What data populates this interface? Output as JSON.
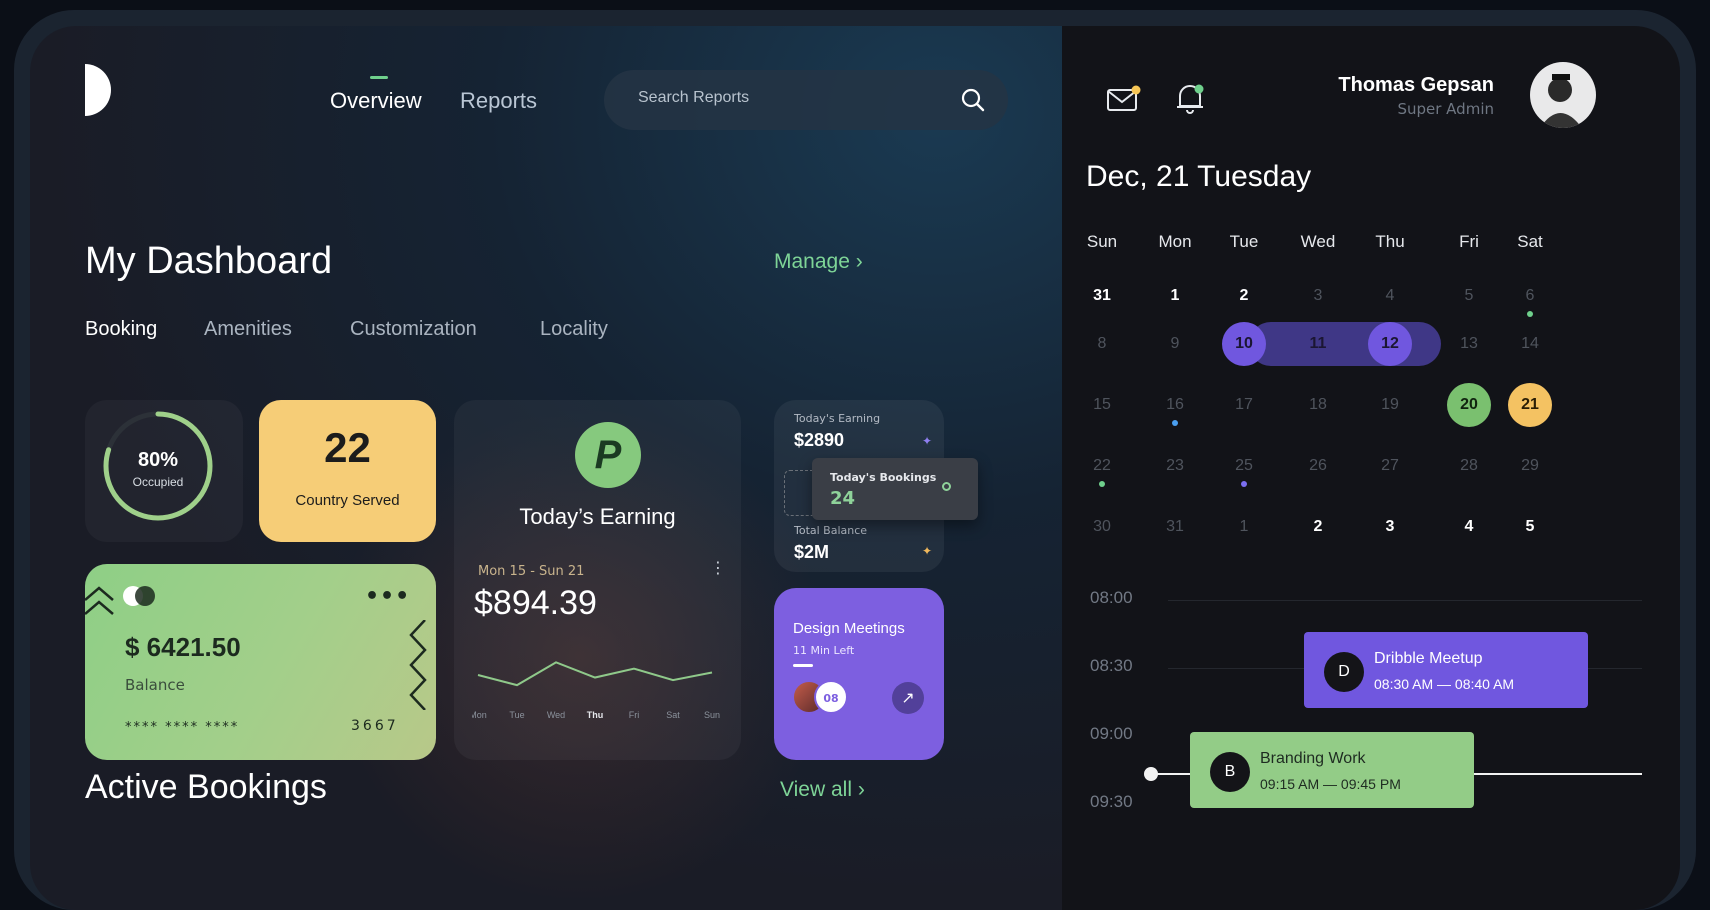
{
  "nav": {
    "overview": "Overview",
    "reports": "Reports"
  },
  "search": {
    "placeholder": "Search Reports"
  },
  "dashboard": {
    "title": "My Dashboard",
    "manage": "Manage",
    "tabs": [
      "Booking",
      "Amenities",
      "Customization",
      "Locality"
    ]
  },
  "occupied": {
    "percent": "80%",
    "label": "Occupied",
    "fraction": 0.8
  },
  "country": {
    "value": "22",
    "label": "Country Served"
  },
  "balance_card": {
    "amount": "$ 6421.50",
    "label": "Balance",
    "masked": "****  ****  ****",
    "last4": "3667",
    "menu": "•••"
  },
  "earning": {
    "badge": "P",
    "title": "Today’s Earning",
    "range": "Mon 15 - Sun 21",
    "menu": "⋮",
    "value": "$894.39",
    "days": [
      "Mon",
      "Tue",
      "Wed",
      "Thu",
      "Fri",
      "Sat",
      "Sun"
    ],
    "chart_data": {
      "type": "line",
      "x": [
        "Mon",
        "Tue",
        "Wed",
        "Thu",
        "Fri",
        "Sat",
        "Sun"
      ],
      "series": [
        {
          "values": [
            30,
            22,
            40,
            28,
            35,
            26,
            32
          ]
        }
      ]
    }
  },
  "mini_stats": {
    "today_earning_label": "Today's Earning",
    "today_earning_value": "$2890",
    "total_balance_label": "Total Balance",
    "total_balance_value": "$2M",
    "bookings_label": "Today's Bookings",
    "bookings_value": "24"
  },
  "meetings": {
    "title": "Design Meetings",
    "subtitle": "11 Min Left",
    "count": "08",
    "arrow": "↗"
  },
  "active_bookings": {
    "title": "Active Bookings",
    "view_all": "View all"
  },
  "user": {
    "name": "Thomas Gepsan",
    "role": "Super Admin"
  },
  "calendar": {
    "title": "Dec, 21 Tuesday",
    "dows": [
      "Sun",
      "Mon",
      "Tue",
      "Wed",
      "Thu",
      "Fri",
      "Sat"
    ],
    "weeks": [
      [
        "31",
        "1",
        "2",
        "3",
        "4",
        "5",
        "6"
      ],
      [
        "8",
        "9",
        "10",
        "11",
        "12",
        "13",
        "14"
      ],
      [
        "15",
        "16",
        "17",
        "18",
        "19",
        "20",
        "21"
      ],
      [
        "22",
        "23",
        "25",
        "26",
        "27",
        "28",
        "29"
      ],
      [
        "30",
        "31",
        "1",
        "2",
        "3",
        "4",
        "5"
      ]
    ]
  },
  "schedule": {
    "times": [
      "08:00",
      "08:30",
      "09:00",
      "09:30"
    ],
    "events": [
      {
        "badge": "D",
        "name": "Dribble Meetup",
        "time": "08:30 AM — 08:40 AM"
      },
      {
        "badge": "B",
        "name": "Branding Work",
        "time": "09:15 AM — 09:45 PM"
      }
    ]
  },
  "colors": {
    "accent_green": "#7ed497",
    "purple": "#7057df",
    "yellow": "#f6cd77"
  }
}
